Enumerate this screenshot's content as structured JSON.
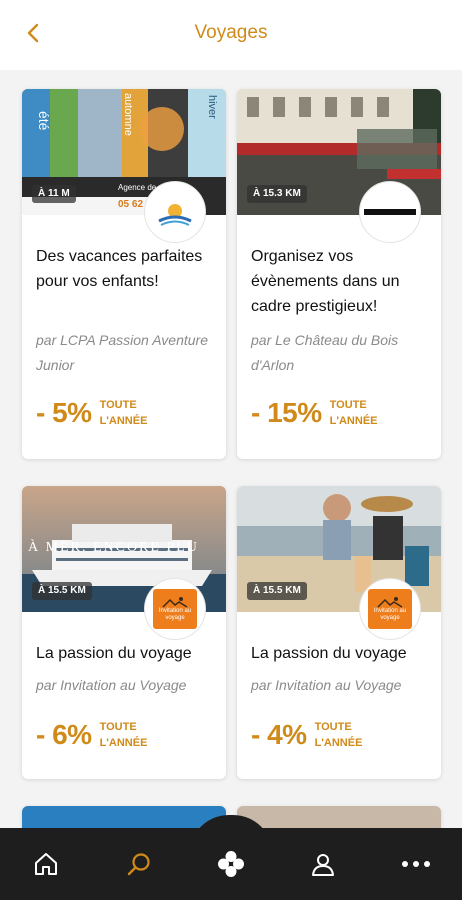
{
  "header": {
    "title": "Voyages",
    "back_icon": "chevron-left-icon"
  },
  "cards": [
    {
      "distance": "À 11 M",
      "title": "Des vacances parfaites pour vos enfants!",
      "author": "par LCPA Passion Aventure Junior",
      "discount": "- 5%",
      "discount_note": "TOUTE L'ANNÉE",
      "image_text_1": "été",
      "image_text_2": "automne",
      "image_text_3": "hiver",
      "image_text_4": "Agence de voyages",
      "image_text_5": "05 62 71"
    },
    {
      "distance": "À 15.3 KM",
      "title": "Organisez vos évènements dans un cadre prestigieux!",
      "author": "par Le Château du Bois d'Arlon",
      "discount": "- 15%",
      "discount_note": "TOUTE L'ANNÉE"
    },
    {
      "distance": "À 15.5 KM",
      "title": "La passion du voyage",
      "author": "par Invitation au Voyage",
      "discount": "- 6%",
      "discount_note": "TOUTE L'ANNÉE",
      "image_text_1": "À MER, ENCORE PLU",
      "logo_text": "Invitation au voyage"
    },
    {
      "distance": "À 15.5 KM",
      "title": "La passion du voyage",
      "author": "par Invitation au Voyage",
      "discount": "- 4%",
      "discount_note": "TOUTE L'ANNÉE",
      "logo_text": "Invitation au voyage"
    }
  ],
  "bottom_nav": {
    "items": [
      "home-icon",
      "search-icon",
      "clover-icon",
      "profile-icon",
      "more-icon"
    ],
    "active": "search-icon"
  },
  "colors": {
    "accent": "#d08a1a",
    "nav_bg": "#1e1e1e",
    "page_bg": "#f3f3f3"
  }
}
